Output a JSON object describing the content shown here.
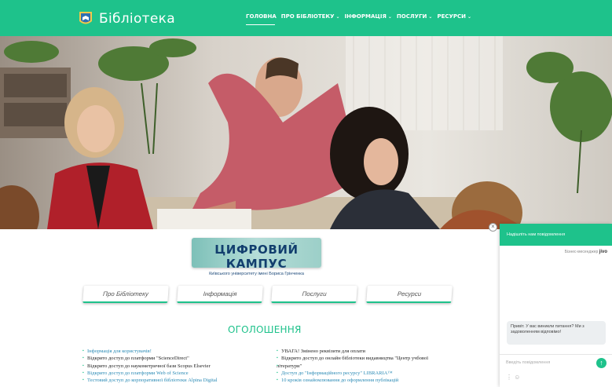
{
  "header": {
    "brand": "Бібліотека",
    "nav": [
      {
        "label": "ГОЛОВНА",
        "dropdown": false
      },
      {
        "label": "ПРО БІБЛІОТЕКУ",
        "dropdown": true
      },
      {
        "label": "ІНФОРМАЦІЯ",
        "dropdown": true
      },
      {
        "label": "ПОСЛУГИ",
        "dropdown": true
      },
      {
        "label": "РЕСУРСИ",
        "dropdown": true
      }
    ]
  },
  "campus": {
    "title": "ЦИФРОВИЙ КАМПУС",
    "subtitle": "Київського університету імені Бориса Грінченка"
  },
  "sections": [
    "Про Бібліотеку",
    "Інформація",
    "Послуги",
    "Ресурси"
  ],
  "announcements": {
    "title": "ОГОЛОШЕННЯ",
    "left": [
      {
        "text": "Інформація для користувачів!",
        "link": true
      },
      {
        "text": "Відкрито доступ до платформи \"ScienceDirect\"",
        "link": false
      },
      {
        "text": "Відкрито доступ до наукометричної бази Scopus Elsevier",
        "link": false
      },
      {
        "text": "Відкрито доступ до платформи Web of Science",
        "link": true
      },
      {
        "text": "Тестовий доступ до корпоративної бібліотеки Alpina Digital",
        "link": true
      }
    ],
    "right": [
      {
        "text": "УВАГА! Змінено реквізити для оплати",
        "link": false
      },
      {
        "text": "Відкрито доступ до онлайн бібліотеки видавництва \"Центр учбової",
        "link": false
      },
      {
        "text": "літератури\"",
        "link": false
      },
      {
        "text": "Доступ до \"Інформаційного ресурсу\" LIBRARIA™",
        "link": true
      },
      {
        "text": "10 кроків ознайомлювання до оформлення публікацій",
        "link": true
      }
    ]
  },
  "chat": {
    "header": "Надішліть нам повідомлення",
    "brand_prefix": "Бізнес-месенджер",
    "brand_name": "jivo",
    "bubble": "Привіт. У вас виникли питання? Ми з задоволенням відповімо!",
    "input_placeholder": "Введіть повідомлення",
    "icons": {
      "send": "arrow-up-icon",
      "close": "close-icon"
    },
    "accent": "#1ec28b"
  },
  "colors": {
    "brand_green": "#1ec28b",
    "link_blue": "#2a8ab5",
    "campus_navy": "#123e6e"
  }
}
